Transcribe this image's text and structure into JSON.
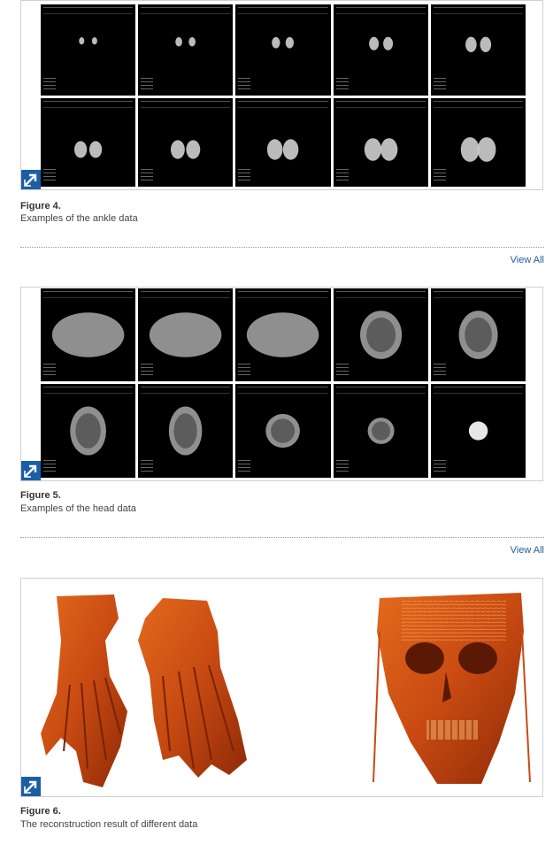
{
  "figures": [
    {
      "title": "Figure 4.",
      "caption": "Examples of the ankle data",
      "expand_icon": "expand-arrow-icon"
    },
    {
      "title": "Figure 5.",
      "caption": "Examples of the head data",
      "expand_icon": "expand-arrow-icon"
    },
    {
      "title": "Figure 6.",
      "caption": "The reconstruction result of different data",
      "expand_icon": "expand-arrow-icon"
    }
  ],
  "links": {
    "view_all_1": "View All",
    "view_all_2": "View All"
  },
  "colors": {
    "link": "#1f5ea0",
    "expand_button": "#1b5ea8",
    "render_bone": "#c84a12"
  }
}
